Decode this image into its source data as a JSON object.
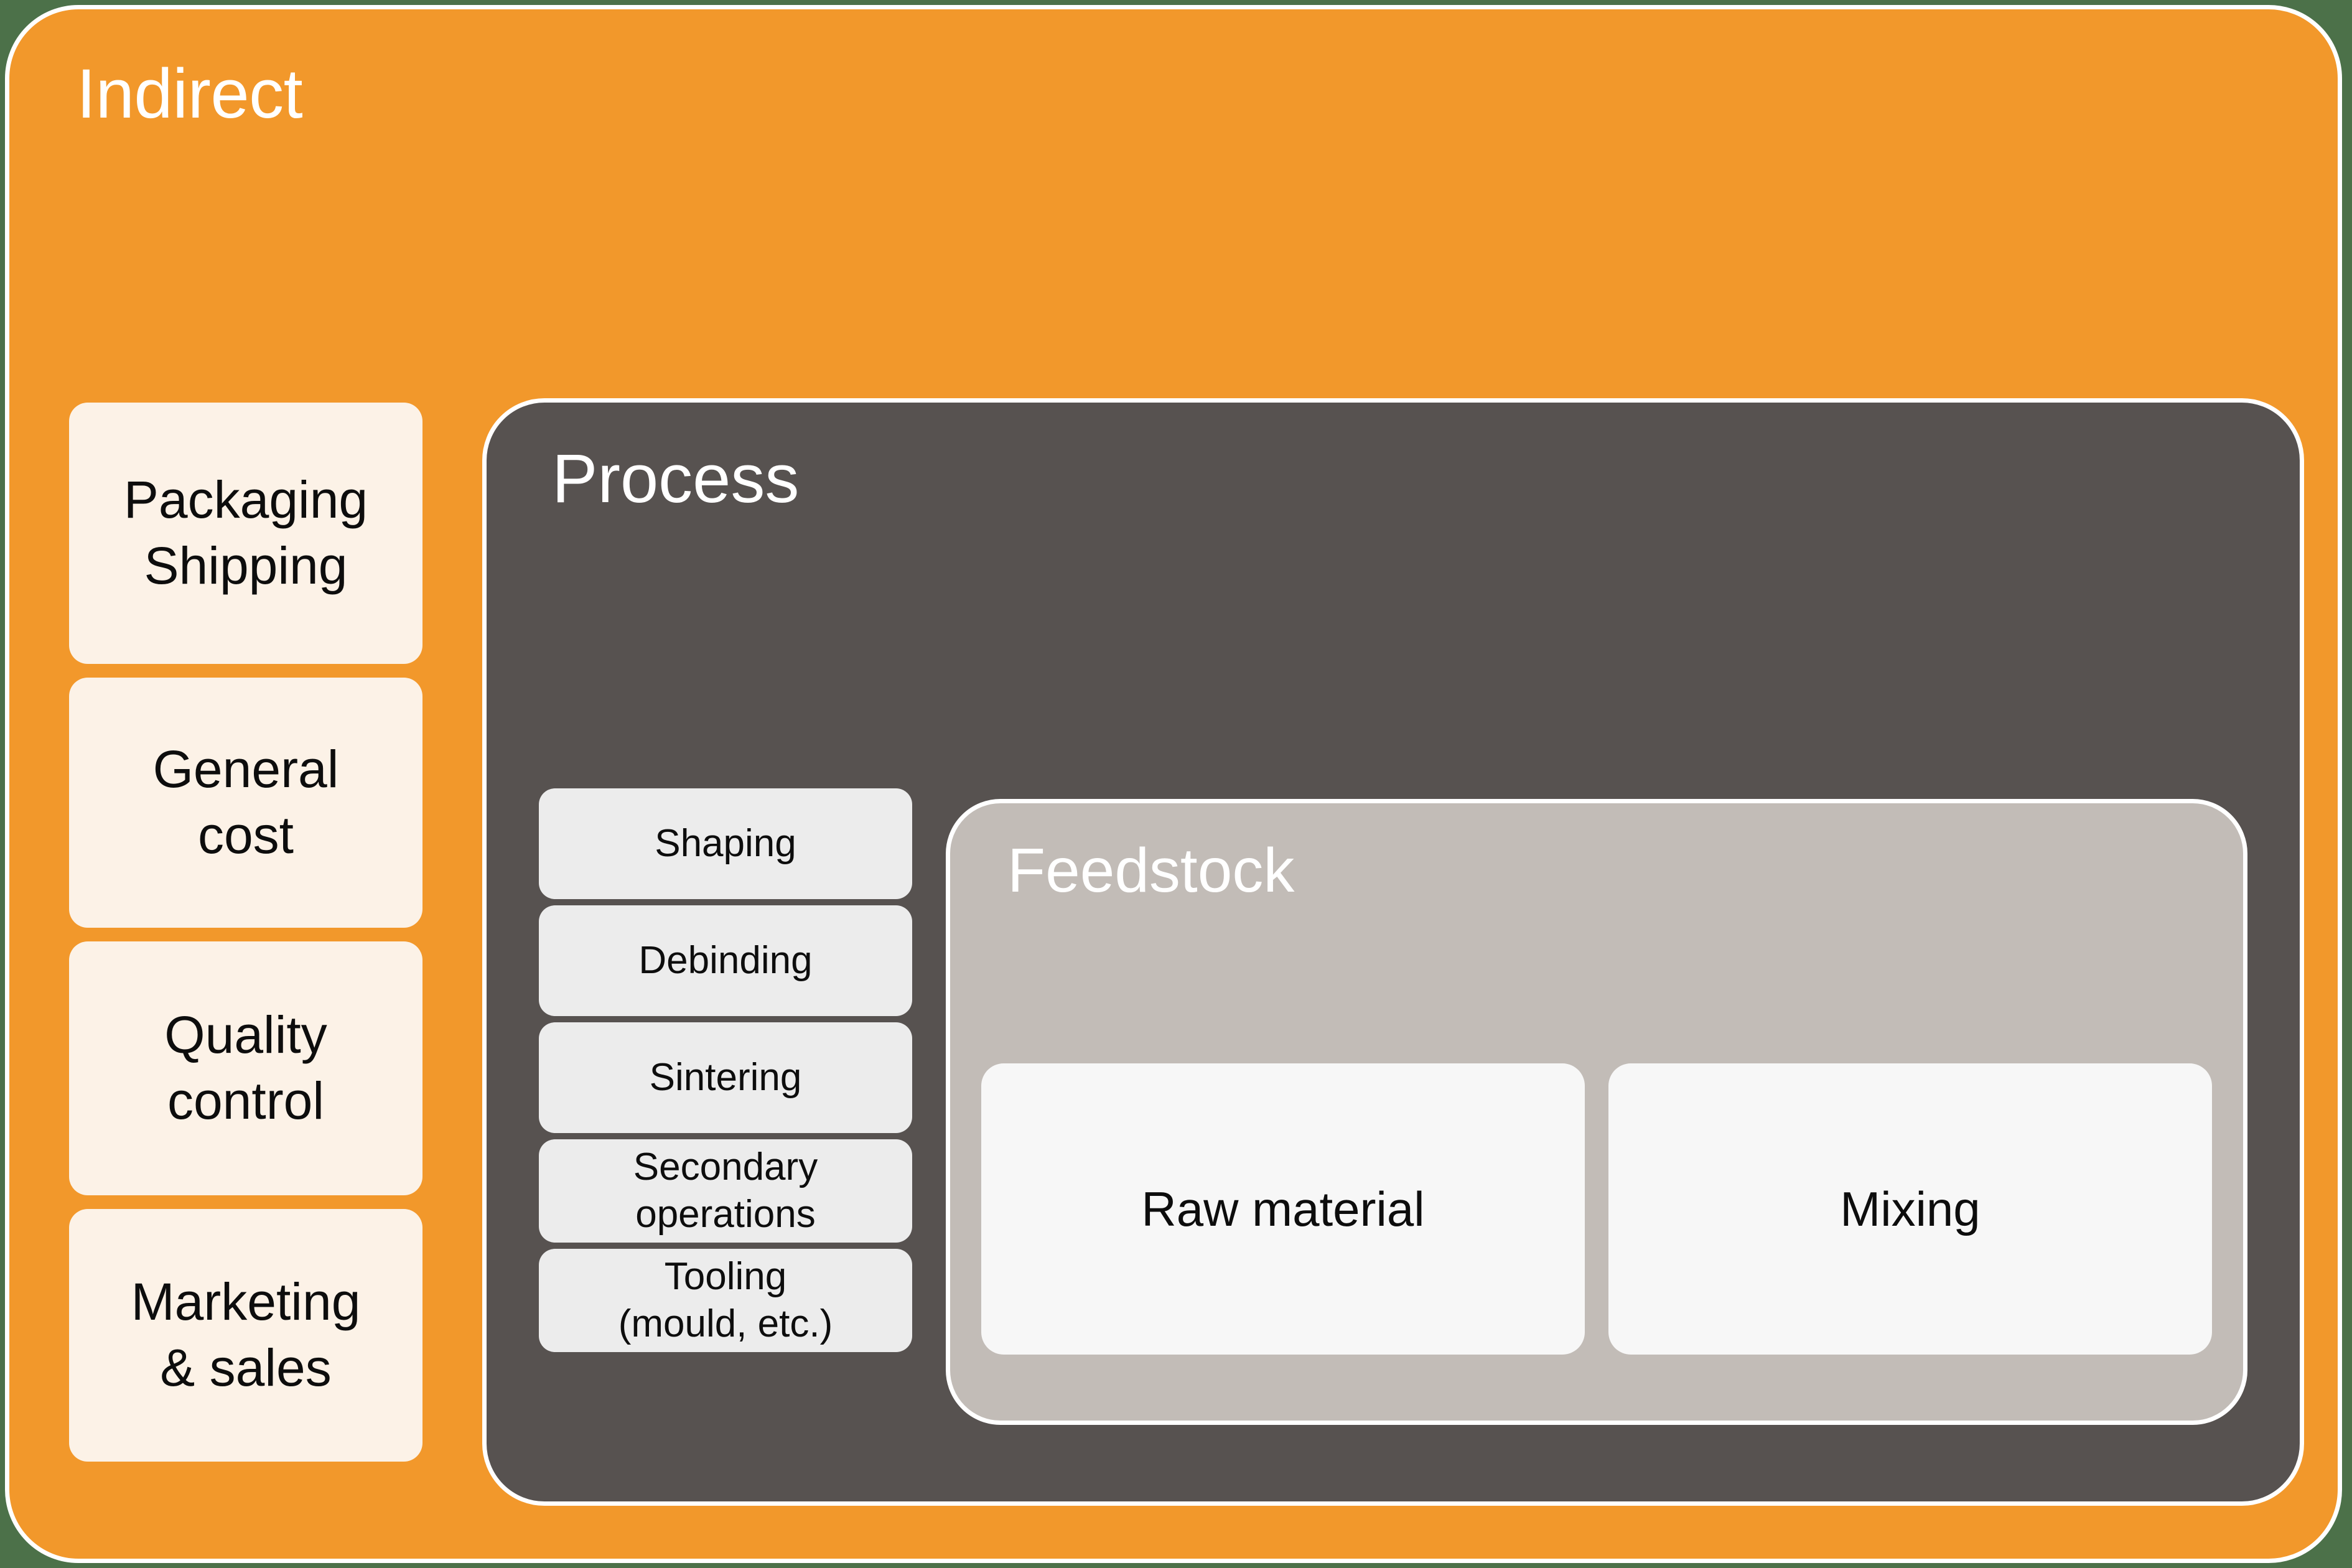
{
  "colors": {
    "page_background": "#4c7149",
    "indirect_fill": "#F2982B",
    "process_fill": "#575250",
    "feedstock_fill": "#C2BCB7",
    "sidebar_card_fill": "#FCF2E7",
    "step_chip_fill": "#ECECEC",
    "feed_card_fill": "#F7F7F7",
    "outline": "#FFFFFF",
    "title_text": "#FFFFFF",
    "body_text": "#0D0D0D"
  },
  "indirect": {
    "title": "Indirect",
    "sidebar_items": [
      {
        "lines": [
          "Packaging",
          "Shipping"
        ]
      },
      {
        "lines": [
          "General",
          "cost"
        ]
      },
      {
        "lines": [
          "Quality",
          "control"
        ]
      },
      {
        "lines": [
          "Marketing",
          "& sales"
        ]
      }
    ]
  },
  "process": {
    "title": "Process",
    "steps": [
      {
        "lines": [
          "Shaping"
        ]
      },
      {
        "lines": [
          "Debinding"
        ]
      },
      {
        "lines": [
          "Sintering"
        ]
      },
      {
        "lines": [
          "Secondary",
          "operations"
        ]
      },
      {
        "lines": [
          "Tooling",
          "(mould, etc.)"
        ]
      }
    ]
  },
  "feedstock": {
    "title": "Feedstock",
    "cards": [
      {
        "label": "Raw material"
      },
      {
        "label": "Mixing"
      }
    ]
  }
}
